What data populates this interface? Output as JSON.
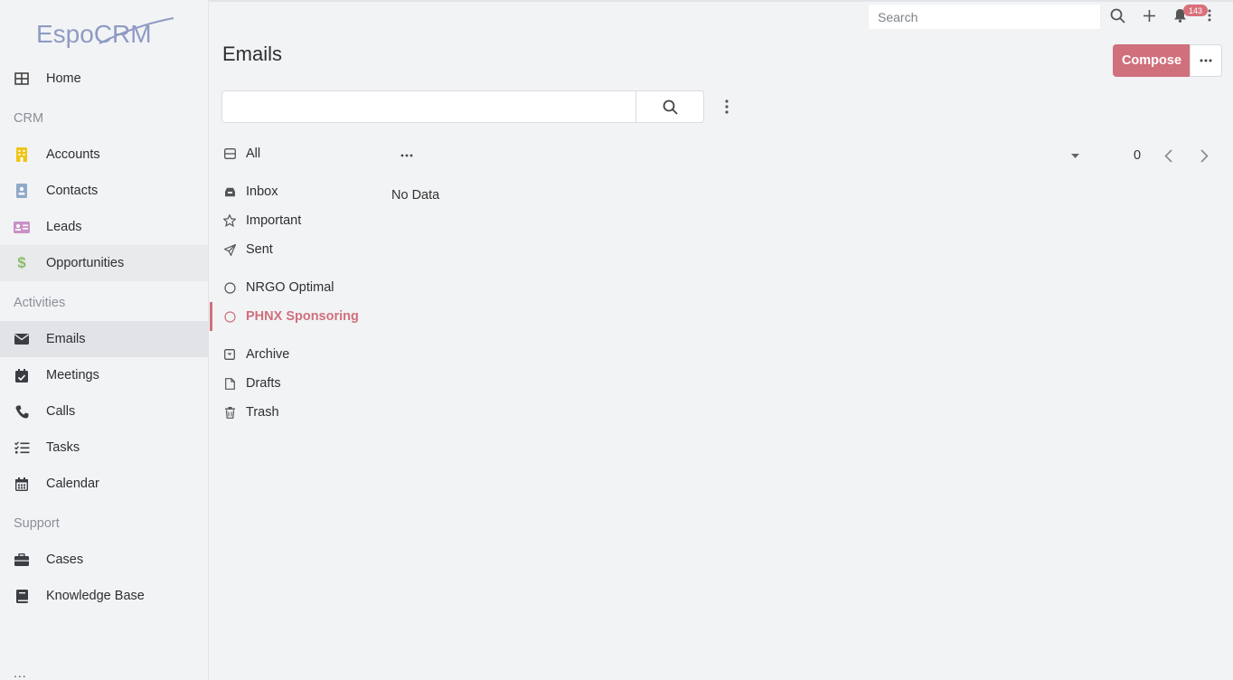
{
  "app": {
    "logo_text": "EspoCRM"
  },
  "header": {
    "search_placeholder": "Search",
    "notification_count": "143"
  },
  "sidebar": {
    "items": [
      {
        "label": "Home",
        "icon": "grid-icon"
      },
      {
        "group": "CRM"
      },
      {
        "label": "Accounts",
        "icon": "building-icon",
        "color": "#f0c419"
      },
      {
        "label": "Contacts",
        "icon": "contact-card-icon",
        "color": "#8fa9c9"
      },
      {
        "label": "Leads",
        "icon": "id-card-icon",
        "color": "#c991c6"
      },
      {
        "label": "Opportunities",
        "icon": "dollar-icon",
        "color": "#8cbc6b"
      },
      {
        "group": "Activities"
      },
      {
        "label": "Emails",
        "icon": "envelope-icon"
      },
      {
        "label": "Meetings",
        "icon": "calendar-check-icon"
      },
      {
        "label": "Calls",
        "icon": "phone-icon"
      },
      {
        "label": "Tasks",
        "icon": "task-list-icon"
      },
      {
        "label": "Calendar",
        "icon": "calendar-grid-icon"
      },
      {
        "group": "Support"
      },
      {
        "label": "Cases",
        "icon": "briefcase-icon"
      },
      {
        "label": "Knowledge Base",
        "icon": "book-icon"
      }
    ],
    "more_label": "..."
  },
  "main": {
    "title": "Emails",
    "compose_label": "Compose",
    "folders": [
      {
        "label": "All",
        "icon": "inbox-tray-icon"
      },
      {
        "label": "Inbox",
        "icon": "inbox-icon"
      },
      {
        "label": "Important",
        "icon": "star-icon"
      },
      {
        "label": "Sent",
        "icon": "paper-plane-icon"
      },
      {
        "label": "NRGO Optimal",
        "icon": "circle-icon"
      },
      {
        "label": "PHNX Sponsoring",
        "icon": "circle-icon",
        "active": true
      },
      {
        "label": "Archive",
        "icon": "archive-icon"
      },
      {
        "label": "Drafts",
        "icon": "file-icon"
      },
      {
        "label": "Trash",
        "icon": "trash-icon"
      }
    ],
    "total_count": "0",
    "empty_text": "No Data"
  },
  "colors": {
    "accent": "#d0707d",
    "badge": "#d9707b",
    "background": "#f2f3f5"
  }
}
